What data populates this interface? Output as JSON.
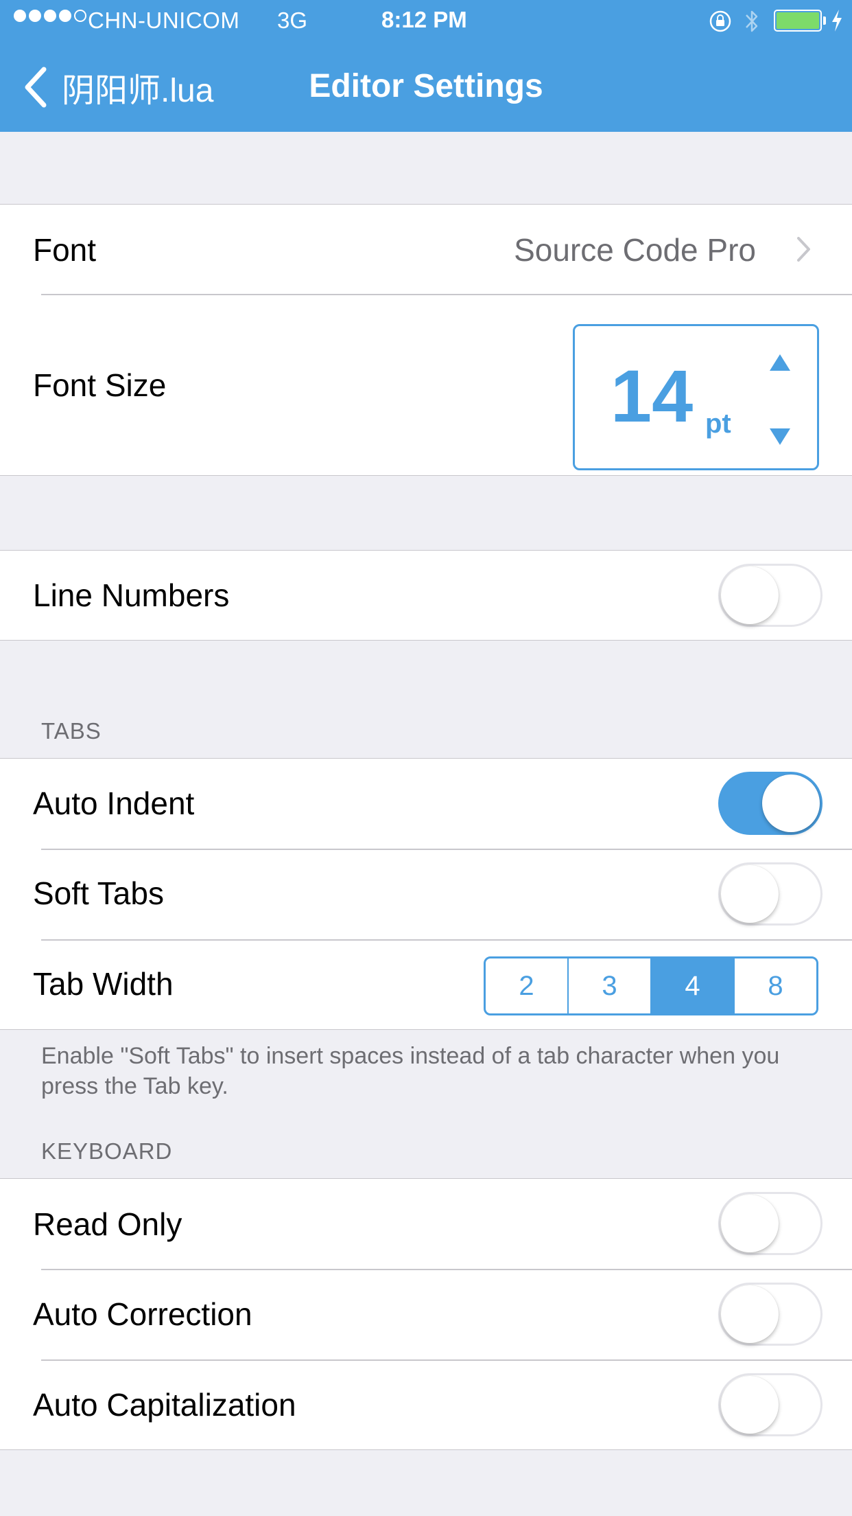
{
  "status_bar": {
    "carrier": "CHN-UNICOM",
    "network": "3G",
    "time": "8:12 PM",
    "signal_bars_filled": 4,
    "signal_bars_total": 5,
    "battery_color": "#7ddb6a"
  },
  "nav": {
    "back_label": "阴阳师.lua",
    "title": "Editor Settings",
    "bar_color": "#4a9fe1"
  },
  "appearance": {
    "font_label": "Font",
    "font_value": "Source Code Pro",
    "font_size_label": "Font Size",
    "font_size_value": "14",
    "font_size_unit": "pt"
  },
  "line_numbers": {
    "label": "Line Numbers",
    "enabled": false
  },
  "tabs": {
    "header": "TABS",
    "auto_indent": {
      "label": "Auto Indent",
      "enabled": true
    },
    "soft_tabs": {
      "label": "Soft Tabs",
      "enabled": false
    },
    "tab_width": {
      "label": "Tab Width",
      "options": [
        "2",
        "3",
        "4",
        "8"
      ],
      "selected": "4"
    },
    "footer": "Enable \"Soft Tabs\" to insert spaces instead of a tab character when you press the Tab key."
  },
  "keyboard": {
    "header": "KEYBOARD",
    "read_only": {
      "label": "Read Only",
      "enabled": false
    },
    "auto_correction": {
      "label": "Auto Correction",
      "enabled": false
    },
    "auto_capitalization": {
      "label": "Auto Capitalization",
      "enabled": false
    }
  },
  "icons": {
    "back": "chevron-left-icon",
    "disclosure": "chevron-right-icon",
    "increment": "triangle-up-icon",
    "decrement": "triangle-down-icon",
    "orientation_lock": "orientation-lock-icon",
    "bluetooth": "bluetooth-icon",
    "charging": "lightning-bolt-icon"
  }
}
